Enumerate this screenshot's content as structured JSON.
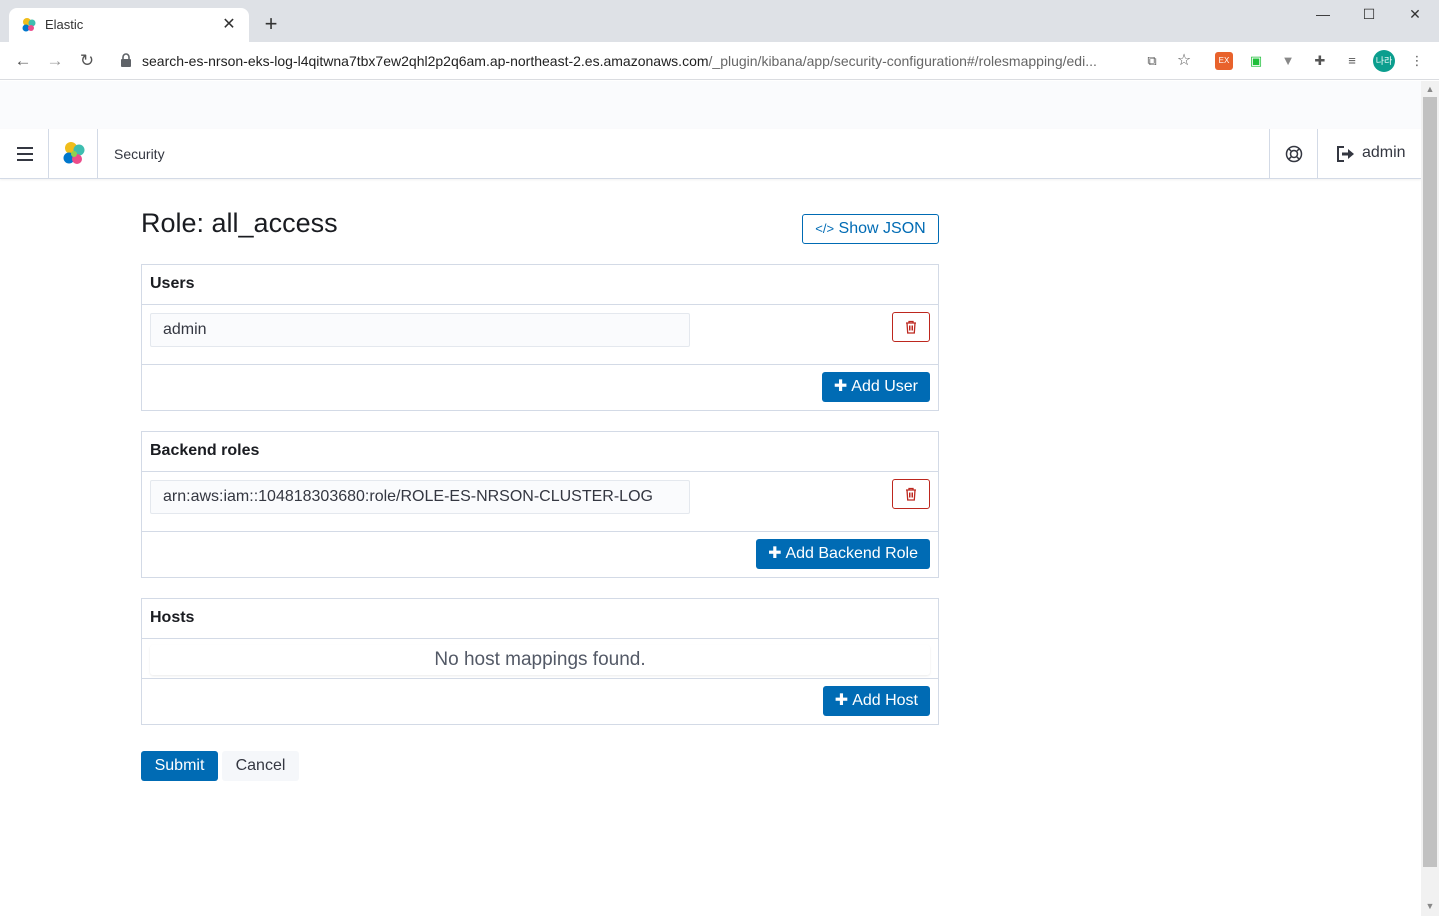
{
  "browser": {
    "tab_title": "Elastic",
    "url_host": "search-es-nrson-eks-log-l4qitwna7tbx7ew2qhl2p2q6am.ap-northeast-2.es.amazonaws.com",
    "url_path": "/_plugin/kibana/app/security-configuration#/rolesmapping/edi...",
    "profile_initials": "나라"
  },
  "header": {
    "breadcrumb": "Security",
    "user_label": "admin"
  },
  "page": {
    "title": "Role: all_access",
    "show_json_label": "Show JSON"
  },
  "users": {
    "heading": "Users",
    "items": [
      "admin"
    ],
    "add_label": "Add User"
  },
  "backend_roles": {
    "heading": "Backend roles",
    "items": [
      "arn:aws:iam::104818303680:role/ROLE-ES-NRSON-CLUSTER-LOG"
    ],
    "add_label": "Add Backend Role"
  },
  "hosts": {
    "heading": "Hosts",
    "empty_text": "No host mappings found.",
    "add_label": "Add Host"
  },
  "actions": {
    "submit_label": "Submit",
    "cancel_label": "Cancel"
  },
  "colors": {
    "primary": "#006bb4",
    "danger": "#bd271e",
    "border": "#d3dae6"
  }
}
